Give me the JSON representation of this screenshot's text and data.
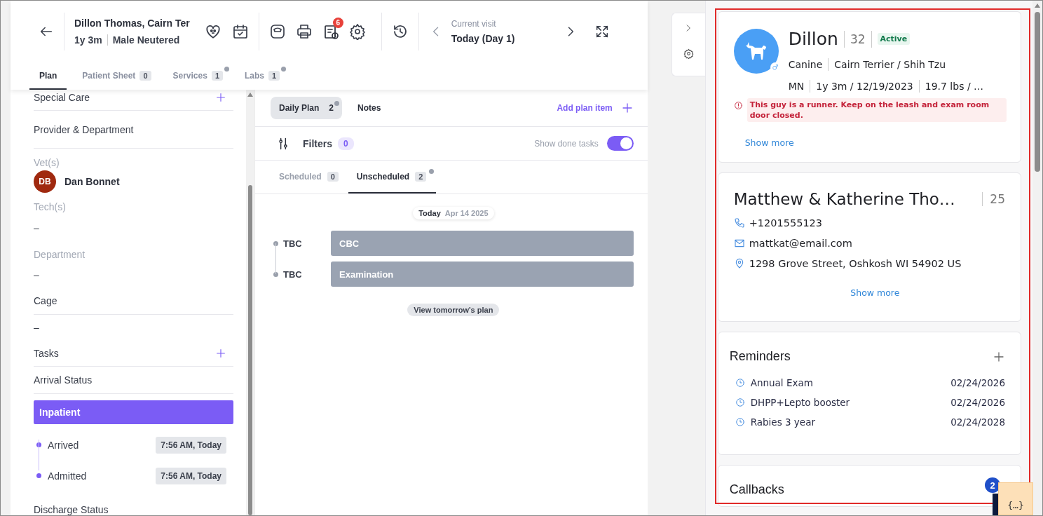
{
  "header": {
    "patient_name": "Dillon Thomas, Cairn Ter",
    "age": "1y 3m",
    "sex": "Male Neutered",
    "tasks_badge": "6",
    "visit_label": "Current visit",
    "visit_value": "Today (Day 1)"
  },
  "tabs": [
    {
      "label": "Plan",
      "selected": true,
      "dot": false
    },
    {
      "label": "Patient Sheet",
      "count": "0",
      "selected": false,
      "dot": false
    },
    {
      "label": "Services",
      "count": "1",
      "selected": false,
      "dot": true
    },
    {
      "label": "Labs",
      "count": "1",
      "selected": false,
      "dot": true
    }
  ],
  "sidebar": {
    "items": [
      {
        "kind": "section",
        "label": "Special Care",
        "add": true
      },
      {
        "kind": "section",
        "label": "Provider & Department",
        "add": false
      },
      {
        "kind": "label",
        "label": "Vet(s)"
      },
      {
        "kind": "person",
        "initials": "DB",
        "name": "Dan Bonnet",
        "color": "#a0290f"
      },
      {
        "kind": "label",
        "label": "Tech(s)"
      },
      {
        "kind": "value",
        "value": "–"
      },
      {
        "kind": "label",
        "label": "Department"
      },
      {
        "kind": "value",
        "value": "–"
      },
      {
        "kind": "section",
        "label": "Cage",
        "add": false
      },
      {
        "kind": "value",
        "value": "–"
      },
      {
        "kind": "section",
        "label": "Tasks",
        "add": true
      },
      {
        "kind": "section",
        "label": "Arrival Status",
        "add": false
      },
      {
        "kind": "status",
        "label": "Inpatient"
      },
      {
        "kind": "timeline",
        "events": [
          {
            "label": "Arrived",
            "time": "7:56 AM, Today"
          },
          {
            "label": "Admitted",
            "time": "7:56 AM, Today"
          }
        ]
      },
      {
        "kind": "heading",
        "label": "Discharge Status"
      }
    ]
  },
  "plan": {
    "tabs": [
      {
        "label": "Daily Plan",
        "count": "2",
        "dot": true,
        "selected": true
      },
      {
        "label": "Notes",
        "selected": false,
        "dot": false
      }
    ],
    "add_item": "Add plan item",
    "filters": {
      "label": "Filters",
      "count": "0"
    },
    "show_done": {
      "label": "Show done tasks",
      "on": true
    },
    "schedule_tabs": [
      {
        "label": "Scheduled",
        "count": "0",
        "dot": false,
        "selected": false
      },
      {
        "label": "Unscheduled",
        "count": "2",
        "dot": true,
        "selected": true
      }
    ],
    "date": {
      "day": "Today",
      "date": "Apr 14 2025"
    },
    "tasks": [
      {
        "time": "TBC",
        "title": "CBC"
      },
      {
        "time": "TBC",
        "title": "Examination"
      }
    ],
    "view_tomorrow": "View tomorrow's plan"
  },
  "patient": {
    "name": "Dillon",
    "number": "32",
    "status": "Active",
    "species": "Canine",
    "breed": "Cairn Terrier / Shih Tzu",
    "sex": "MN",
    "age": "1y 3m / 12/19/2023",
    "weight": "19.7 lbs / …",
    "alert": "This guy is a runner. Keep on the leash and exam room door closed.",
    "show_more": "Show more"
  },
  "client": {
    "name": "Matthew & Katherine Tho…",
    "count": "25",
    "phone": "+1201555123",
    "email": "mattkat@email.com",
    "address": "1298 Grove Street, Oshkosh WI 54902 US",
    "show_more": "Show more"
  },
  "reminders": {
    "title": "Reminders",
    "items": [
      {
        "name": "Annual Exam",
        "date": "02/24/2026"
      },
      {
        "name": "DHPP+Lepto booster",
        "date": "02/24/2026"
      },
      {
        "name": "Rabies 3 year",
        "date": "02/24/2028"
      }
    ]
  },
  "callbacks": {
    "title": "Callbacks"
  },
  "chat": {
    "badge": "2",
    "widget": "{…}"
  }
}
